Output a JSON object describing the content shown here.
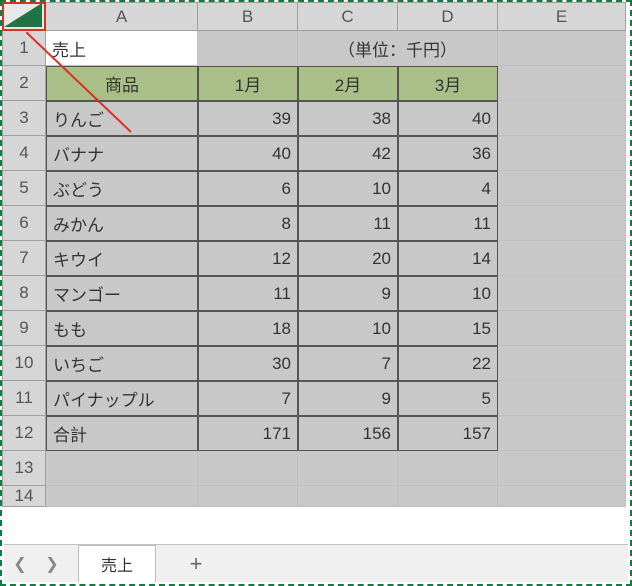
{
  "columns": [
    "A",
    "B",
    "C",
    "D",
    "E"
  ],
  "rows": [
    "1",
    "2",
    "3",
    "4",
    "5",
    "6",
    "7",
    "8",
    "9",
    "10",
    "11",
    "12",
    "13",
    "14"
  ],
  "title": "売上",
  "unit_label": "（単位：千円）",
  "header": {
    "product": "商品",
    "m1": "1月",
    "m2": "2月",
    "m3": "3月"
  },
  "data": [
    {
      "name": "りんご",
      "m1": "39",
      "m2": "38",
      "m3": "40"
    },
    {
      "name": "バナナ",
      "m1": "40",
      "m2": "42",
      "m3": "36"
    },
    {
      "name": "ぶどう",
      "m1": "6",
      "m2": "10",
      "m3": "4"
    },
    {
      "name": "みかん",
      "m1": "8",
      "m2": "11",
      "m3": "11"
    },
    {
      "name": "キウイ",
      "m1": "12",
      "m2": "20",
      "m3": "14"
    },
    {
      "name": "マンゴー",
      "m1": "11",
      "m2": "9",
      "m3": "10"
    },
    {
      "name": "もも",
      "m1": "18",
      "m2": "10",
      "m3": "15"
    },
    {
      "name": "いちご",
      "m1": "30",
      "m2": "7",
      "m3": "22"
    },
    {
      "name": "パイナップル",
      "m1": "7",
      "m2": "9",
      "m3": "5"
    },
    {
      "name": "合計",
      "m1": "171",
      "m2": "156",
      "m3": "157"
    }
  ],
  "sheet_tab": "売上",
  "chart_data": {
    "type": "table",
    "title": "売上",
    "unit": "千円",
    "categories": [
      "りんご",
      "バナナ",
      "ぶどう",
      "みかん",
      "キウイ",
      "マンゴー",
      "もも",
      "いちご",
      "パイナップル",
      "合計"
    ],
    "series": [
      {
        "name": "1月",
        "values": [
          39,
          40,
          6,
          8,
          12,
          11,
          18,
          30,
          7,
          171
        ]
      },
      {
        "name": "2月",
        "values": [
          38,
          42,
          10,
          11,
          20,
          9,
          10,
          7,
          9,
          156
        ]
      },
      {
        "name": "3月",
        "values": [
          40,
          36,
          4,
          11,
          14,
          10,
          15,
          22,
          5,
          157
        ]
      }
    ]
  }
}
